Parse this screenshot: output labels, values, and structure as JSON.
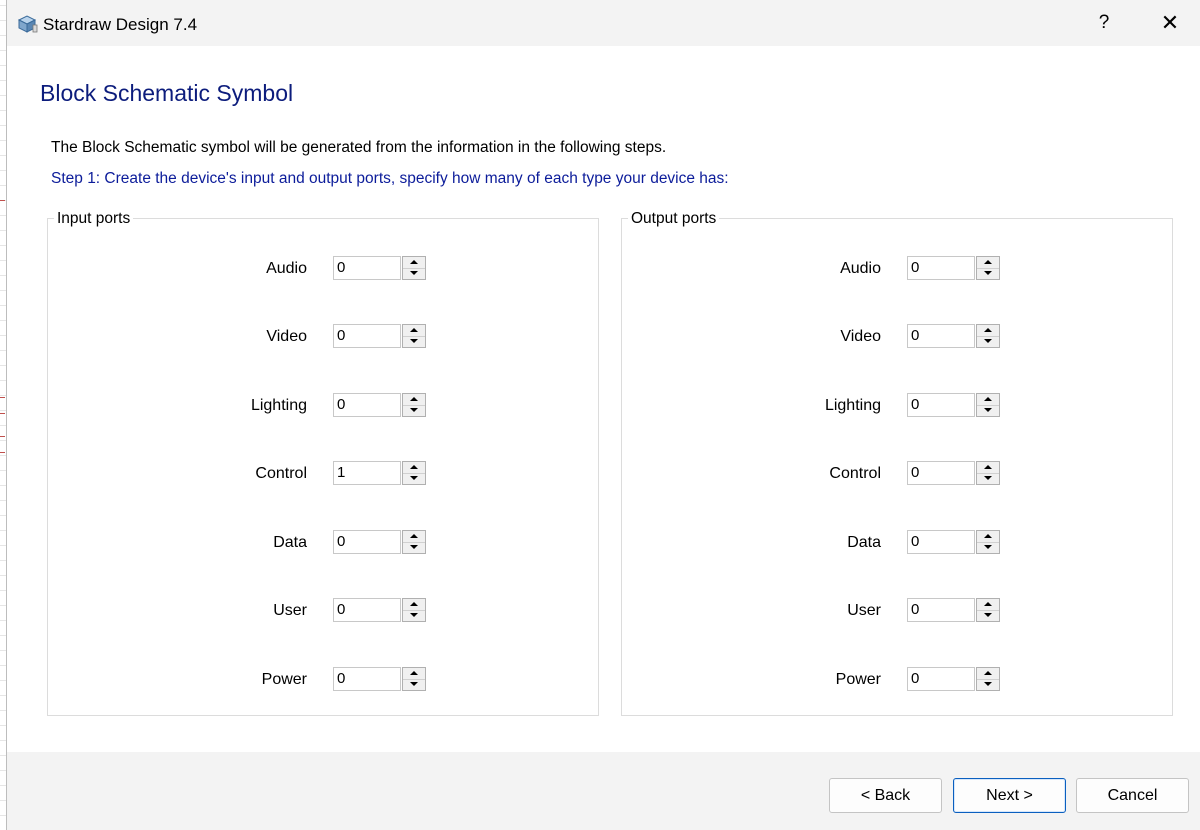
{
  "window": {
    "title": "Stardraw Design 7.4",
    "help_label": "?",
    "close_label": "✕"
  },
  "page": {
    "title": "Block Schematic Symbol",
    "intro": "The Block Schematic symbol will be generated from the information in the following steps.",
    "step": "Step 1: Create the device's input and output ports, specify how many of each type your device has:"
  },
  "input_ports": {
    "legend": "Input ports",
    "rows": [
      {
        "label": "Audio",
        "value": "0"
      },
      {
        "label": "Video",
        "value": "0"
      },
      {
        "label": "Lighting",
        "value": "0"
      },
      {
        "label": "Control",
        "value": "1"
      },
      {
        "label": "Data",
        "value": "0"
      },
      {
        "label": "User",
        "value": "0"
      },
      {
        "label": "Power",
        "value": "0"
      }
    ]
  },
  "output_ports": {
    "legend": "Output ports",
    "rows": [
      {
        "label": "Audio",
        "value": "0"
      },
      {
        "label": "Video",
        "value": "0"
      },
      {
        "label": "Lighting",
        "value": "0"
      },
      {
        "label": "Control",
        "value": "0"
      },
      {
        "label": "Data",
        "value": "0"
      },
      {
        "label": "User",
        "value": "0"
      },
      {
        "label": "Power",
        "value": "0"
      }
    ]
  },
  "footer": {
    "back_label": "< Back",
    "next_label": "Next >",
    "cancel_label": "Cancel"
  },
  "colors": {
    "title": "#0c1c7c",
    "step_text": "#0c1c9a",
    "next_border": "#0a5fbf"
  }
}
